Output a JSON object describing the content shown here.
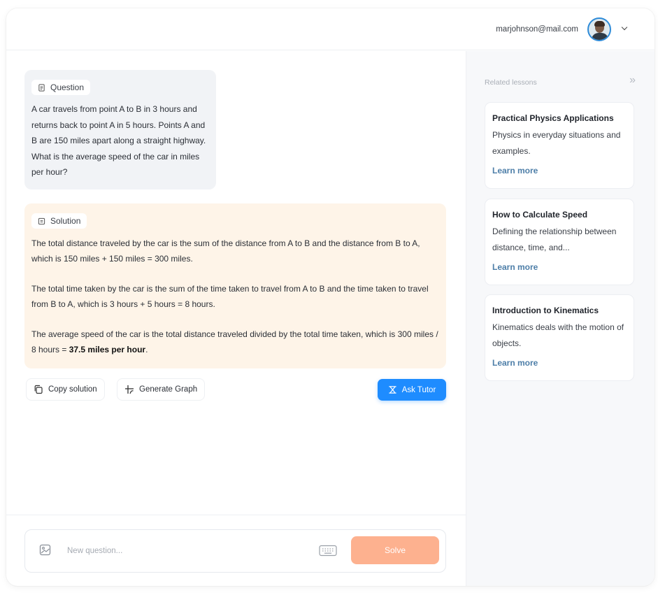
{
  "header": {
    "user_email": "marjohnson@mail.com"
  },
  "question": {
    "tag_label": "Question",
    "text": "A car travels from point A to B in 3 hours and returns back to point A in 5 hours. Points A and B are 150 miles apart along a straight highway. What is the average speed of the car in miles per hour?"
  },
  "solution": {
    "tag_label": "Solution",
    "para1": "The total distance traveled by the car is the sum of the distance from A to B and the distance from B to A, which is 150 miles + 150 miles = 300 miles.",
    "para2": "The total time taken by the car is the sum of the time taken to travel from A to B and the time taken to travel from B to A, which is 3 hours + 5 hours = 8 hours.",
    "para3_prefix": "The average speed of the car is the total distance traveled divided by the total time taken, which is 300 miles / 8 hours = ",
    "para3_bold": "37.5 miles per hour",
    "para3_suffix": "."
  },
  "actions": {
    "copy_label": "Copy solution",
    "graph_label": "Generate Graph",
    "ask_tutor_label": "Ask Tutor"
  },
  "composer": {
    "placeholder": "New question...",
    "solve_label": "Solve"
  },
  "sidebar": {
    "header": "Related lessons",
    "collapse_glyph": "»",
    "lessons": [
      {
        "title": "Practical Physics Applications",
        "desc": "Physics in everyday situations and examples.",
        "link": "Learn more"
      },
      {
        "title": "How to Calculate Speed",
        "desc": "Defining the relationship between distance, time, and...",
        "link": "Learn more"
      },
      {
        "title": "Introduction to Kinematics",
        "desc": "Kinematics deals with the motion of objects.",
        "link": "Learn more"
      }
    ]
  },
  "colors": {
    "accent_blue": "#1e8cff",
    "solve_orange": "#fdb18f",
    "solution_bg": "#fef4e8",
    "question_bg": "#f1f3f6",
    "link_blue": "#4d7ea8"
  }
}
